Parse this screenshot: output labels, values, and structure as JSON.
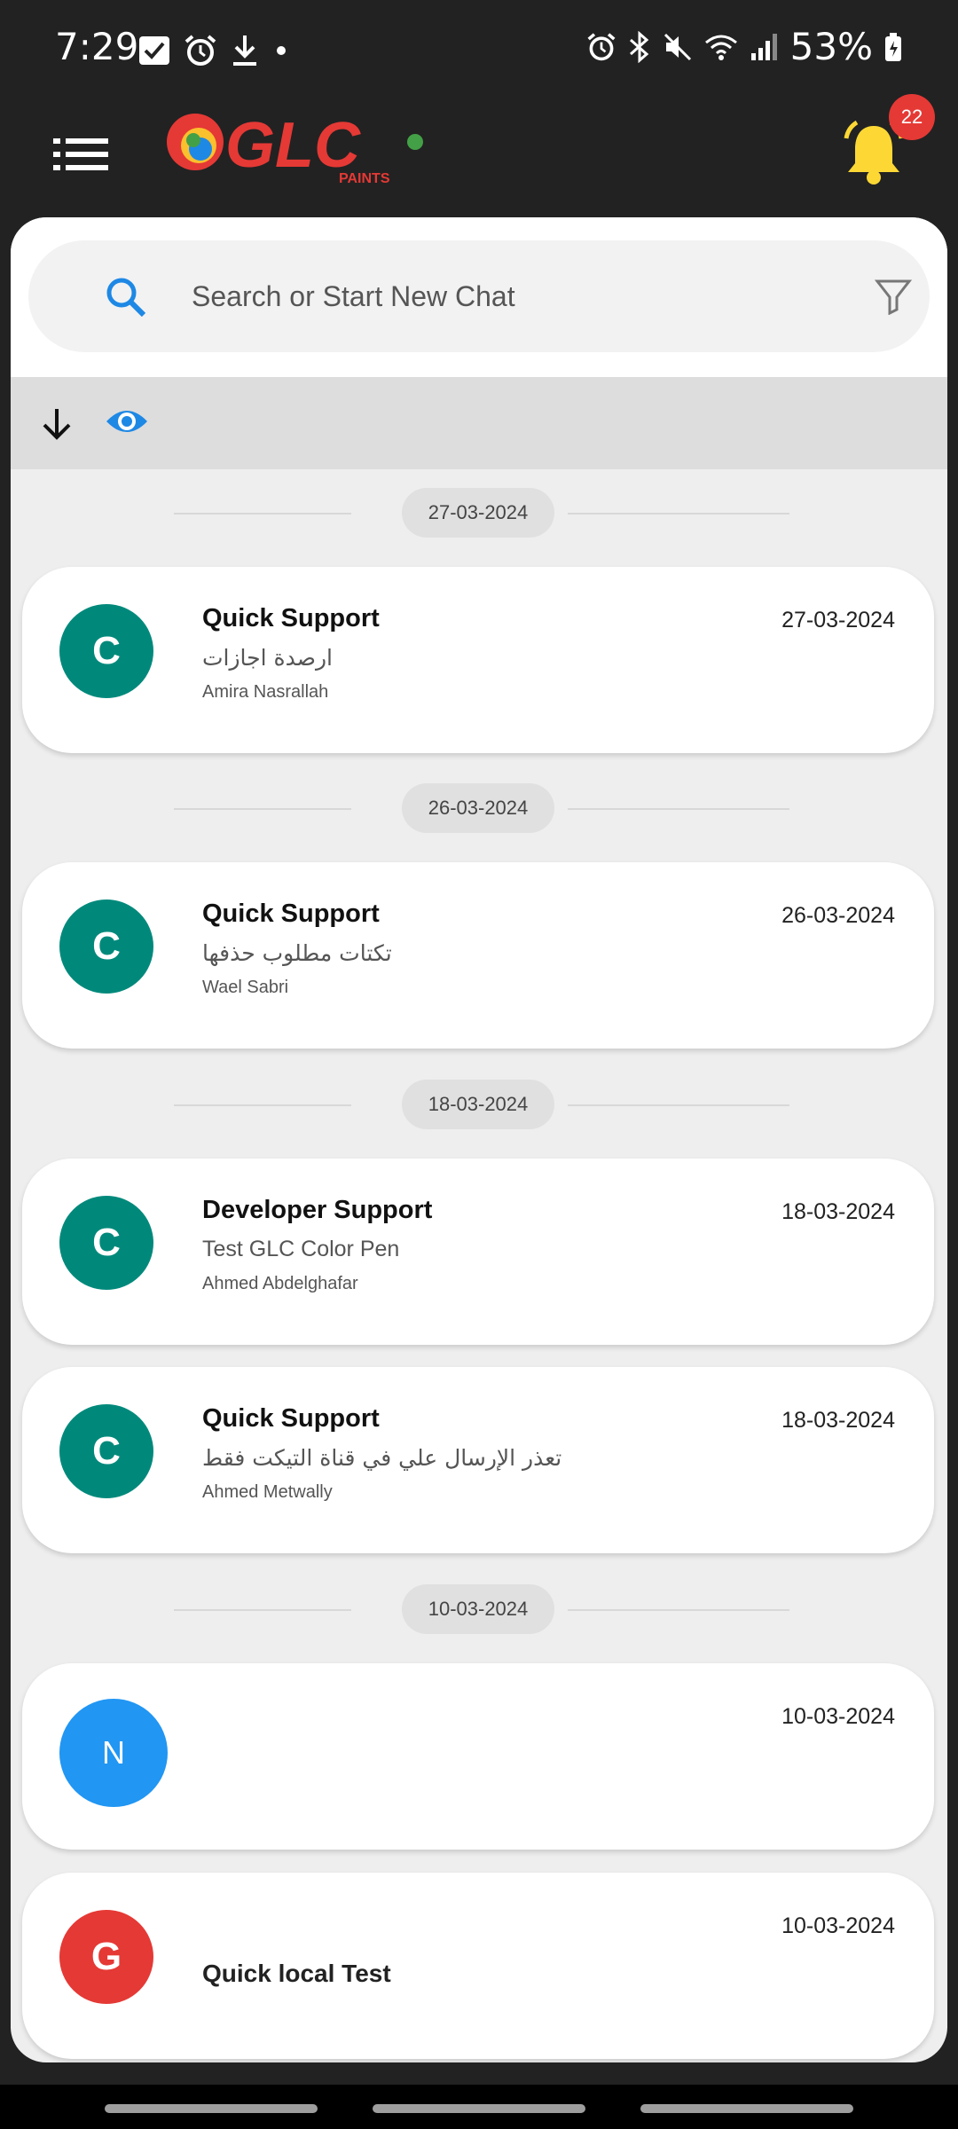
{
  "status_bar": {
    "time": "7:29",
    "battery": "53%"
  },
  "app_bar": {
    "logo_text": "GLC",
    "logo_subtext": "PAINTS",
    "notification_count": "22"
  },
  "search": {
    "placeholder": "Search or Start New Chat"
  },
  "colors": {
    "teal": "#00897b",
    "blue": "#2196f3",
    "red": "#e53935",
    "accent_blue": "#1e88e5",
    "bell_yellow": "#fdd835"
  },
  "sections": [
    {
      "date": "27-03-2024"
    },
    {
      "date": "26-03-2024"
    },
    {
      "date": "18-03-2024"
    },
    {
      "date": "10-03-2024"
    }
  ],
  "chats": [
    {
      "avatar": "C",
      "title": "Quick Support",
      "message": "ارصدة اجازات",
      "sender": "Amira Nasrallah",
      "date": "27-03-2024"
    },
    {
      "avatar": "C",
      "title": "Quick Support",
      "message": "تكتات مطلوب حذفها",
      "sender": "Wael Sabri",
      "date": "26-03-2024"
    },
    {
      "avatar": "C",
      "title": "Developer Support",
      "message": "Test GLC Color Pen",
      "sender": "Ahmed Abdelghafar",
      "date": "18-03-2024"
    },
    {
      "avatar": "C",
      "title": "Quick Support",
      "message": "تعذر الإرسال علي في قناة التيكت فقط",
      "sender": "Ahmed Metwally",
      "date": "18-03-2024"
    },
    {
      "avatar": "N",
      "title": "",
      "message": "",
      "sender": "",
      "date": "10-03-2024"
    },
    {
      "avatar": "G",
      "title": "Quick local Test",
      "message": "",
      "sender": "",
      "date": "10-03-2024"
    }
  ]
}
